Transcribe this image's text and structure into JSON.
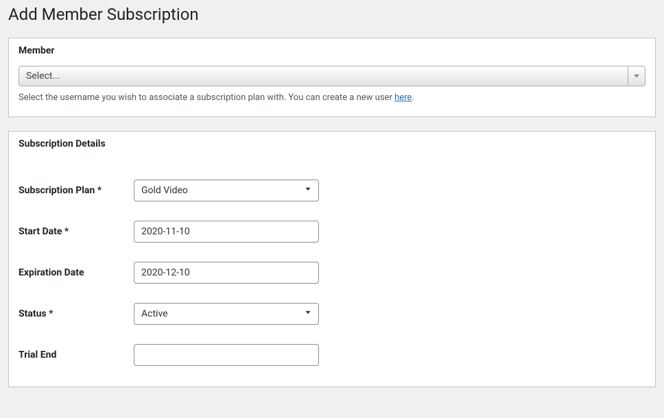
{
  "page": {
    "title": "Add Member Subscription"
  },
  "memberPanel": {
    "heading": "Member",
    "select": {
      "placeholder": "Select..."
    },
    "helper_prefix": "Select the username you wish to associate a subscription plan with. You can create a new user ",
    "helper_link": "here",
    "helper_suffix": "."
  },
  "subscriptionPanel": {
    "heading": "Subscription Details",
    "fields": {
      "plan": {
        "label": "Subscription Plan *",
        "value": "Gold Video"
      },
      "start_date": {
        "label": "Start Date *",
        "value": "2020-11-10"
      },
      "expiration_date": {
        "label": "Expiration Date",
        "value": "2020-12-10"
      },
      "status": {
        "label": "Status *",
        "value": "Active"
      },
      "trial_end": {
        "label": "Trial End",
        "value": ""
      }
    }
  }
}
